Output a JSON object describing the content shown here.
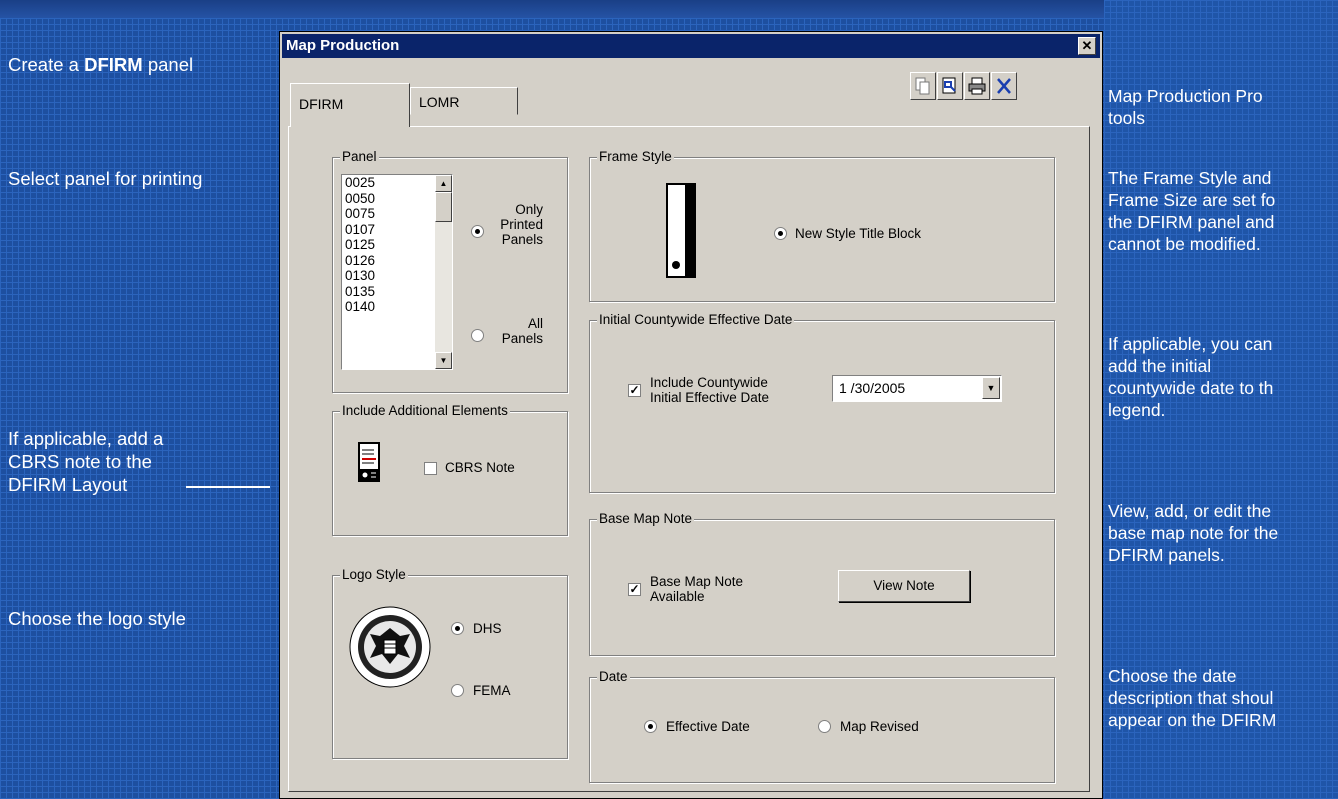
{
  "annotations_left": {
    "create_prefix": "Create a ",
    "create_bold": "DFIRM",
    "create_suffix": " panel",
    "select_panel": "Select panel for printing",
    "cbrs_line1": "If applicable, add a",
    "cbrs_line2": "CBRS note to the",
    "cbrs_line3": "DFIRM Layout",
    "logo_style": "Choose the logo style"
  },
  "annotations_right": {
    "tools_line1": "Map Production Pro",
    "tools_line2": "tools",
    "frame_line1": "The Frame Style and",
    "frame_line2": "Frame Size are set fo",
    "frame_line3": "the DFIRM panel and",
    "frame_line4": "cannot be modified.",
    "initial_line1": "If applicable, you can",
    "initial_line2": "add the initial",
    "initial_line3": "countywide date to th",
    "initial_line4": "legend.",
    "note_line1": "View, add, or edit the",
    "note_line2": "base map note for the",
    "note_line3": "DFIRM panels.",
    "date_line1": "Choose the date",
    "date_line2": "description that shoul",
    "date_line3": "appear on the DFIRM"
  },
  "window": {
    "title": "Map Production",
    "close_glyph": "✕",
    "tabs": [
      "DFIRM",
      "LOMR"
    ],
    "toolbar_icons": [
      "copy-icon",
      "page-icon",
      "printer-icon",
      "close-x-icon"
    ]
  },
  "panel_group": {
    "label": "Panel",
    "items": [
      "0025",
      "0050",
      "0075",
      "0107",
      "0125",
      "0126",
      "0130",
      "0135",
      "0140"
    ],
    "only_printed_line1": "Only",
    "only_printed_line2": "Printed",
    "only_printed_line3": "Panels",
    "all_line1": "All",
    "all_line2": "Panels",
    "selected": "Only Printed Panels"
  },
  "additional_group": {
    "label": "Include Additional Elements",
    "cbrs_label": "CBRS Note",
    "cbrs_checked": false
  },
  "logo_group": {
    "label": "Logo Style",
    "dhs_label": "DHS",
    "fema_label": "FEMA",
    "selected": "DHS"
  },
  "frame_group": {
    "label": "Frame Style",
    "option_label": "New Style Title Block",
    "selected": true
  },
  "initial_group": {
    "label": "Initial Countywide Effective Date",
    "check_line1": "Include Countywide",
    "check_line2": "Initial Effective Date",
    "checked": true,
    "date_value": "1 /30/2005"
  },
  "basemap_group": {
    "label": "Base Map Note",
    "check_line1": "Base Map Note",
    "check_line2": "Available",
    "checked": true,
    "button_label": "View Note"
  },
  "date_group": {
    "label": "Date",
    "effective_label": "Effective Date",
    "revised_label": "Map Revised",
    "selected": "Effective Date"
  }
}
